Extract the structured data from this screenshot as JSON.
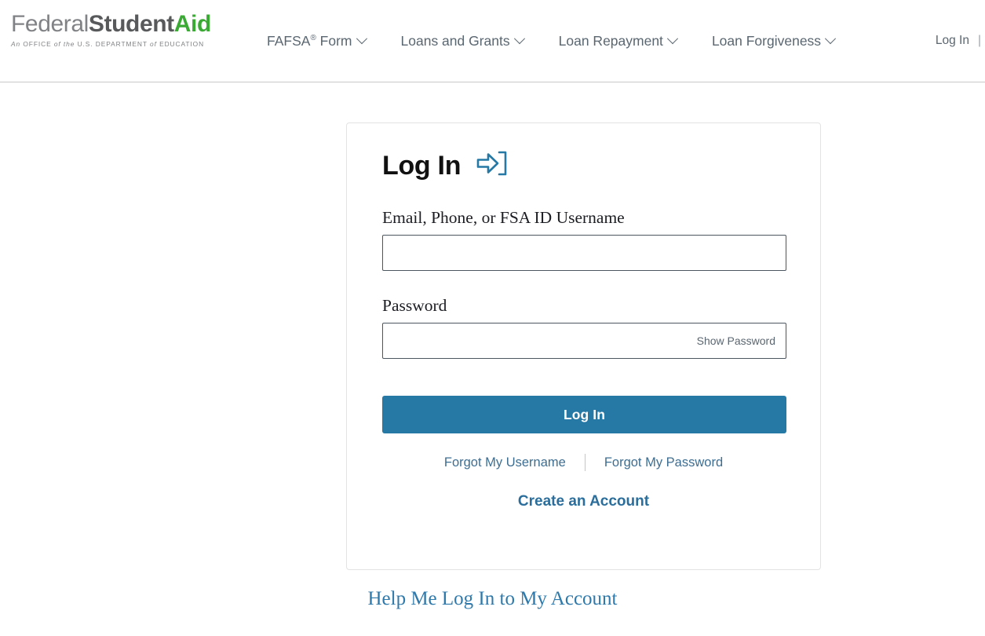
{
  "header": {
    "logo": {
      "word1": "Federal",
      "word2": "Student",
      "word3": "Aid",
      "tagline_part1": "An",
      "tagline_part2": "OFFICE",
      "tagline_part3": "of the",
      "tagline_part4": "U.S. DEPARTMENT",
      "tagline_part5": "of",
      "tagline_part6": "EDUCATION",
      "color_federal": "#808285",
      "color_student": "#58595b",
      "color_aid": "#3aaa35"
    },
    "nav": [
      {
        "label": "FAFSA",
        "superscript": "®",
        "label_rest": " Form",
        "has_caret": true
      },
      {
        "label": "Loans and Grants",
        "superscript": "",
        "label_rest": "",
        "has_caret": true
      },
      {
        "label": "Loan Repayment",
        "superscript": "",
        "label_rest": "",
        "has_caret": true
      },
      {
        "label": "Loan Forgiveness",
        "superscript": "",
        "label_rest": "",
        "has_caret": true
      }
    ],
    "right": {
      "login_label": "Log In",
      "separator": "|"
    }
  },
  "card": {
    "title": "Log In",
    "login_icon_name": "login-arrow-icon",
    "username": {
      "label": "Email, Phone, or FSA ID Username",
      "value": "",
      "placeholder": ""
    },
    "password": {
      "label": "Password",
      "value": "",
      "placeholder": "",
      "show_password_label": "Show Password"
    },
    "submit_label": "Log In",
    "submit_color": "#2678a5",
    "forgot_username_label": "Forgot My Username",
    "forgot_password_label": "Forgot My Password",
    "create_account_label": "Create an Account",
    "link_color": "#3d6e92"
  },
  "footer": {
    "help_label": "Help Me Log In to My Account",
    "help_color": "#2e79ab"
  }
}
